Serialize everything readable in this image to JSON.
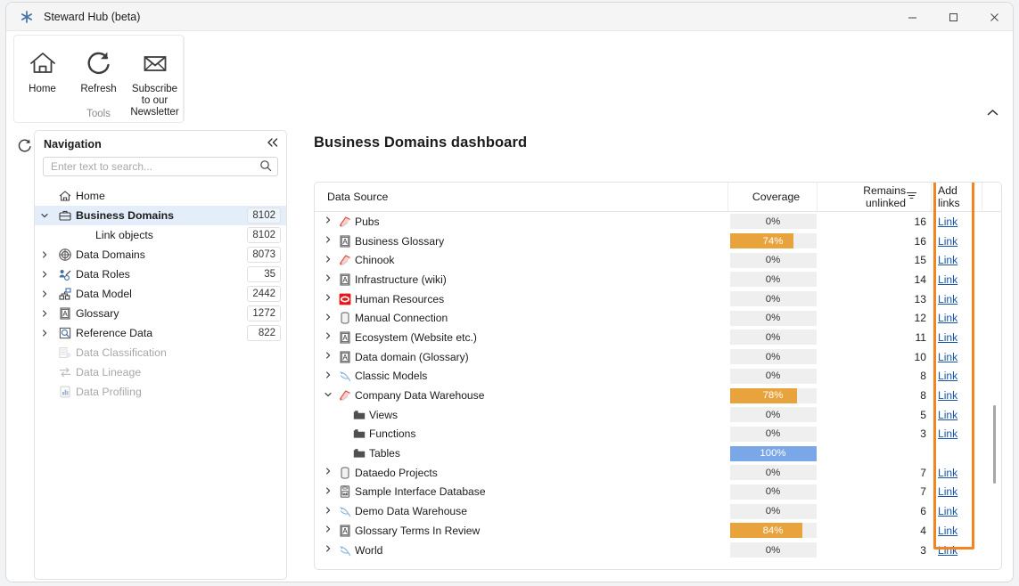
{
  "window": {
    "title": "Steward Hub (beta)",
    "app_icon": "asterisk-icon",
    "minimize_label": "–",
    "maximize_label": "□",
    "close_label": "✕"
  },
  "ribbon": {
    "group_title": "Tools",
    "collapse_label": "⌃",
    "items": [
      {
        "label": "Home",
        "icon": "home-icon"
      },
      {
        "label": "Refresh",
        "icon": "refresh-icon"
      },
      {
        "label": "Subscribe to our Newsletter",
        "icon": "envelope-icon"
      }
    ]
  },
  "left_rail": {
    "refresh_icon": "refresh-icon"
  },
  "navigation": {
    "title": "Navigation",
    "collapse_label": "«",
    "search": {
      "value": "",
      "placeholder": "Enter text to search..."
    },
    "items": [
      {
        "label": "Home",
        "icon": "home-icon",
        "count": "",
        "expander": "",
        "selected": false,
        "dim": false,
        "indent": 0
      },
      {
        "label": "Business Domains",
        "icon": "briefcase-icon",
        "count": "8102",
        "expander": "⌄",
        "selected": true,
        "dim": false,
        "indent": 0
      },
      {
        "label": "Link objects",
        "icon": "",
        "count": "8102",
        "expander": "",
        "selected": false,
        "dim": false,
        "indent": 1
      },
      {
        "label": "Data Domains",
        "icon": "domains-icon",
        "count": "8073",
        "expander": "›",
        "selected": false,
        "dim": false,
        "indent": 0
      },
      {
        "label": "Data Roles",
        "icon": "roles-icon",
        "count": "35",
        "expander": "›",
        "selected": false,
        "dim": false,
        "indent": 0
      },
      {
        "label": "Data Model",
        "icon": "model-icon",
        "count": "2442",
        "expander": "›",
        "selected": false,
        "dim": false,
        "indent": 0
      },
      {
        "label": "Glossary",
        "icon": "glossary-icon",
        "count": "1272",
        "expander": "›",
        "selected": false,
        "dim": false,
        "indent": 0
      },
      {
        "label": "Reference Data",
        "icon": "reference-icon",
        "count": "822",
        "expander": "›",
        "selected": false,
        "dim": false,
        "indent": 0
      },
      {
        "label": "Data Classification",
        "icon": "classification-icon",
        "count": "",
        "expander": "",
        "selected": false,
        "dim": true,
        "indent": 0
      },
      {
        "label": "Data Lineage",
        "icon": "lineage-icon",
        "count": "",
        "expander": "",
        "selected": false,
        "dim": true,
        "indent": 0
      },
      {
        "label": "Data Profiling",
        "icon": "profiling-icon",
        "count": "",
        "expander": "",
        "selected": false,
        "dim": true,
        "indent": 0
      }
    ]
  },
  "dashboard": {
    "title": "Business Domains dashboard",
    "columns": [
      "Data Source",
      "Coverage",
      "Remains unlinked",
      "Add links"
    ],
    "filter_icon": "filter-icon",
    "link_label": "Link",
    "highlight_color": "#f28522",
    "colors": {
      "coverage_orange": "#e8a33d",
      "coverage_blue": "#7aa7e8",
      "coverage_track": "#efefef",
      "link_blue": "#1554a8"
    },
    "rows": [
      {
        "name": "Pubs",
        "icon": "pubs-icon",
        "expander": "›",
        "indent": 0,
        "coverage": "0%",
        "coverage_pct": 0,
        "coverage_color": "",
        "remains": "16",
        "link": "Link"
      },
      {
        "name": "Business Glossary",
        "icon": "glossary-icon",
        "expander": "›",
        "indent": 0,
        "coverage": "74%",
        "coverage_pct": 74,
        "coverage_color": "#e8a33d",
        "remains": "16",
        "link": "Link"
      },
      {
        "name": "Chinook",
        "icon": "pubs-icon",
        "expander": "›",
        "indent": 0,
        "coverage": "0%",
        "coverage_pct": 0,
        "coverage_color": "",
        "remains": "15",
        "link": "Link"
      },
      {
        "name": "Infrastructure (wiki)",
        "icon": "glossary-icon",
        "expander": "›",
        "indent": 0,
        "coverage": "0%",
        "coverage_pct": 0,
        "coverage_color": "",
        "remains": "14",
        "link": "Link"
      },
      {
        "name": "Human Resources",
        "icon": "oracle-icon",
        "expander": "›",
        "indent": 0,
        "coverage": "0%",
        "coverage_pct": 0,
        "coverage_color": "",
        "remains": "13",
        "link": "Link"
      },
      {
        "name": "Manual Connection",
        "icon": "database-icon",
        "expander": "›",
        "indent": 0,
        "coverage": "0%",
        "coverage_pct": 0,
        "coverage_color": "",
        "remains": "12",
        "link": "Link"
      },
      {
        "name": "Ecosystem (Website etc.)",
        "icon": "glossary-icon",
        "expander": "›",
        "indent": 0,
        "coverage": "0%",
        "coverage_pct": 0,
        "coverage_color": "",
        "remains": "11",
        "link": "Link"
      },
      {
        "name": "Data domain (Glossary)",
        "icon": "glossary-icon",
        "expander": "›",
        "indent": 0,
        "coverage": "0%",
        "coverage_pct": 0,
        "coverage_color": "",
        "remains": "10",
        "link": "Link"
      },
      {
        "name": "Classic Models",
        "icon": "dolphin-icon",
        "expander": "›",
        "indent": 0,
        "coverage": "0%",
        "coverage_pct": 0,
        "coverage_color": "",
        "remains": "8",
        "link": "Link"
      },
      {
        "name": "Company Data Warehouse",
        "icon": "pubs-icon",
        "expander": "⌄",
        "indent": 0,
        "coverage": "78%",
        "coverage_pct": 78,
        "coverage_color": "#e8a33d",
        "remains": "8",
        "link": "Link"
      },
      {
        "name": "Views",
        "icon": "folder-icon",
        "expander": "",
        "indent": 1,
        "coverage": "0%",
        "coverage_pct": 0,
        "coverage_color": "",
        "remains": "5",
        "link": "Link"
      },
      {
        "name": "Functions",
        "icon": "folder-icon",
        "expander": "",
        "indent": 1,
        "coverage": "0%",
        "coverage_pct": 0,
        "coverage_color": "",
        "remains": "3",
        "link": "Link"
      },
      {
        "name": "Tables",
        "icon": "folder-icon",
        "expander": "",
        "indent": 1,
        "coverage": "100%",
        "coverage_pct": 100,
        "coverage_color": "#7aa7e8",
        "remains": "",
        "link": ""
      },
      {
        "name": "Dataedo Projects",
        "icon": "database-icon",
        "expander": "›",
        "indent": 0,
        "coverage": "0%",
        "coverage_pct": 0,
        "coverage_color": "",
        "remains": "7",
        "link": "Link"
      },
      {
        "name": "Sample Interface Database",
        "icon": "db-box-icon",
        "expander": "›",
        "indent": 0,
        "coverage": "0%",
        "coverage_pct": 0,
        "coverage_color": "",
        "remains": "7",
        "link": "Link"
      },
      {
        "name": "Demo Data Warehouse",
        "icon": "dolphin-icon",
        "expander": "›",
        "indent": 0,
        "coverage": "0%",
        "coverage_pct": 0,
        "coverage_color": "",
        "remains": "6",
        "link": "Link"
      },
      {
        "name": "Glossary Terms In Review",
        "icon": "glossary-icon",
        "expander": "›",
        "indent": 0,
        "coverage": "84%",
        "coverage_pct": 84,
        "coverage_color": "#e8a33d",
        "remains": "4",
        "link": "Link"
      },
      {
        "name": "World",
        "icon": "dolphin-icon",
        "expander": "›",
        "indent": 0,
        "coverage": "0%",
        "coverage_pct": 0,
        "coverage_color": "",
        "remains": "3",
        "link": "Link"
      }
    ]
  }
}
